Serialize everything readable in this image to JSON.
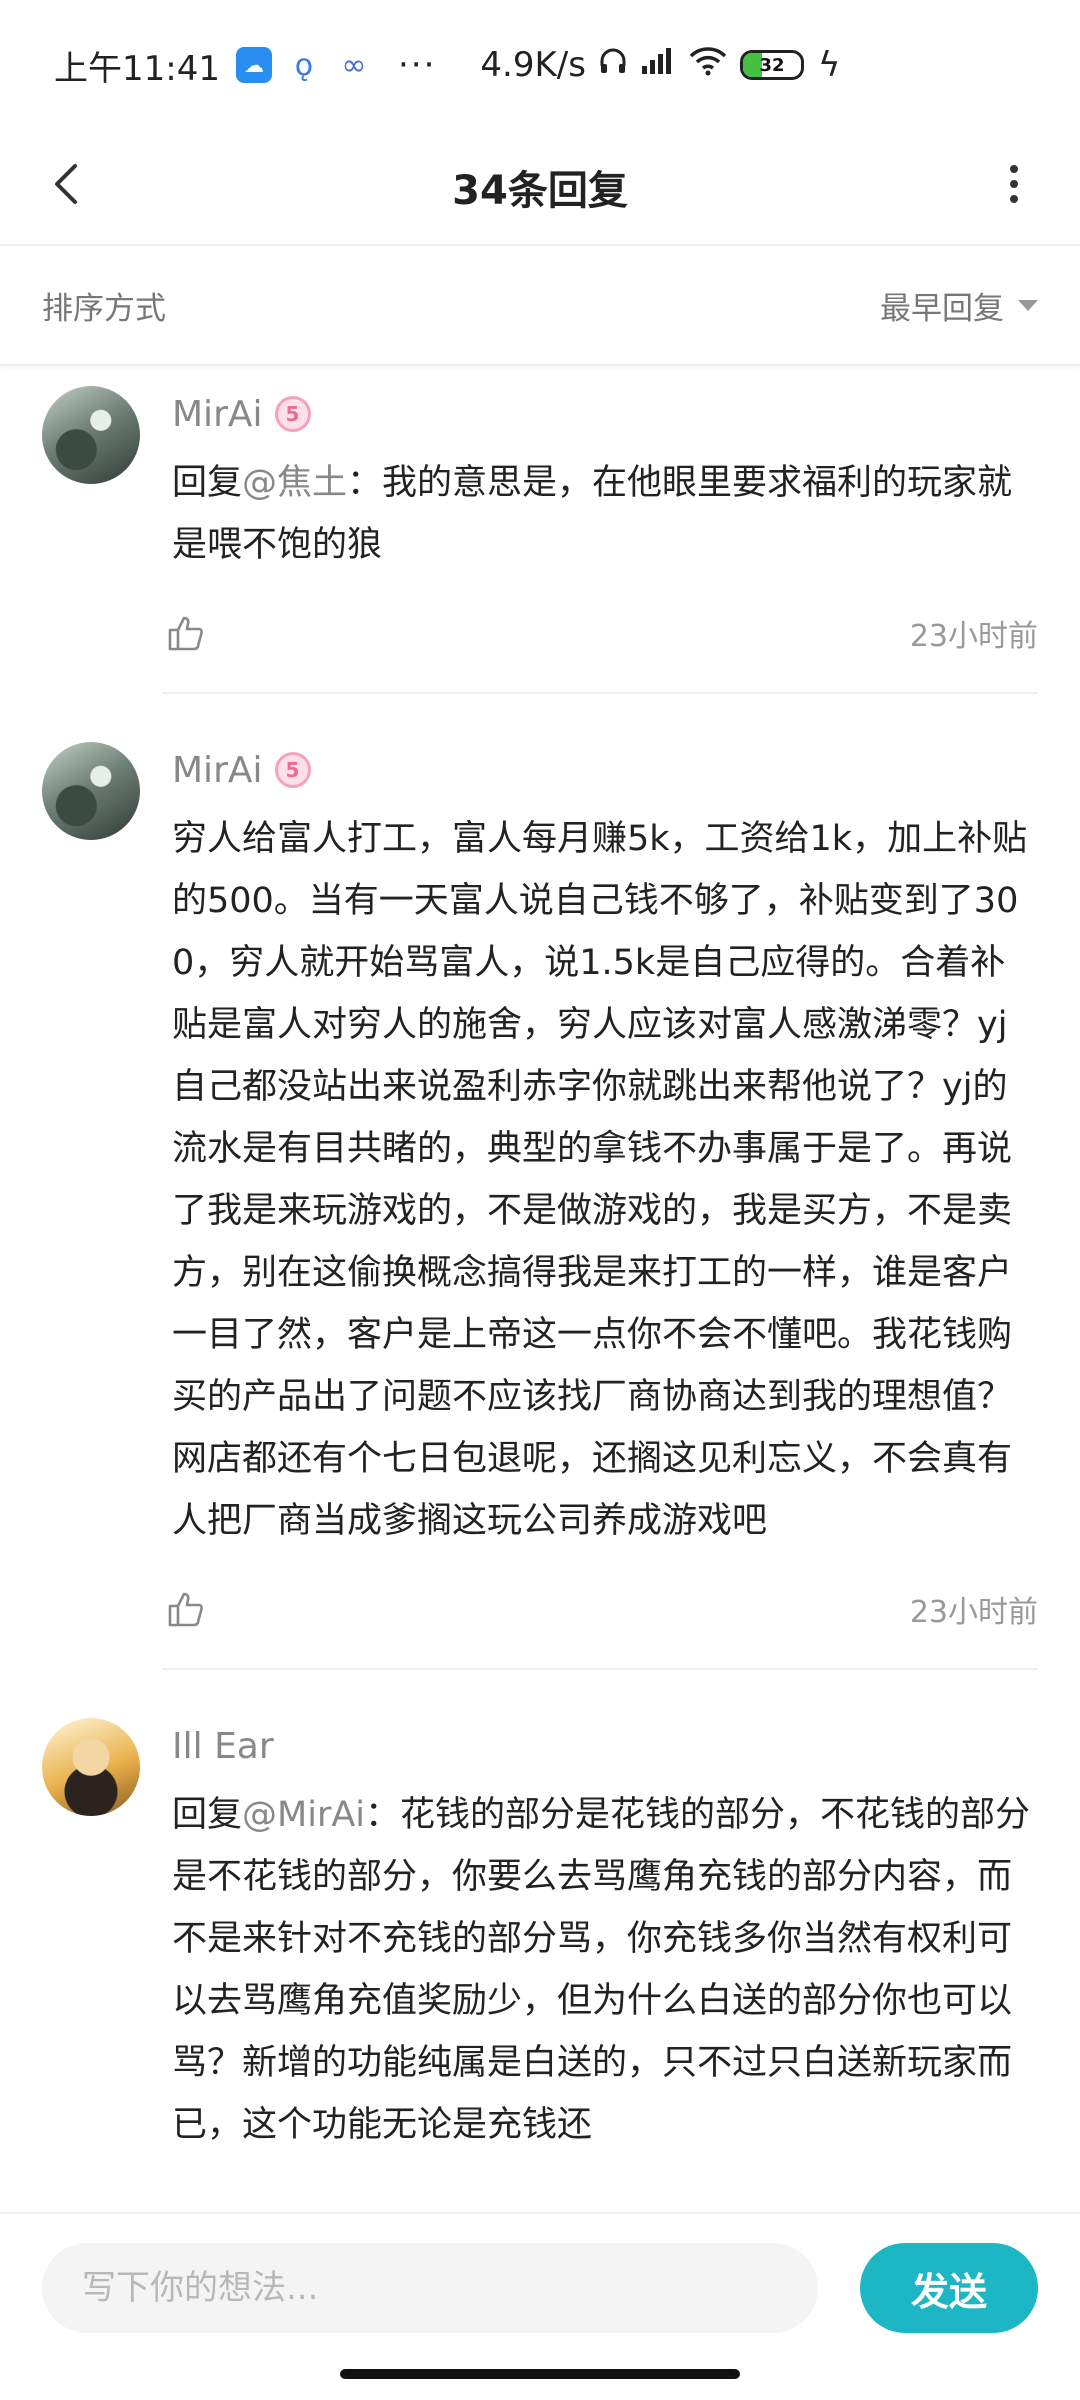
{
  "status_bar": {
    "time": "上午11:41",
    "more": "···",
    "network_speed": "4.9K/s",
    "battery_level": "32",
    "battery_fraction": 0.32
  },
  "header": {
    "title": "34条回复"
  },
  "sort": {
    "label": "排序方式",
    "selected": "最早回复"
  },
  "comments": [
    {
      "name": "MirAi",
      "level": "5",
      "reply_prefix": "回复",
      "mention": "@焦土",
      "text": "：我的意思是，在他眼里要求福利的玩家就是喂不饱的狼",
      "time": "23小时前"
    },
    {
      "name": "MirAi",
      "level": "5",
      "text": "穷人给富人打工，富人每月赚5k，工资给1k，加上补贴的500。当有一天富人说自己钱不够了，补贴变到了300，穷人就开始骂富人，说1.5k是自己应得的。合着补贴是富人对穷人的施舍，穷人应该对富人感激涕零？yj自己都没站出来说盈利赤字你就跳出来帮他说了？yj的流水是有目共睹的，典型的拿钱不办事属于是了。再说了我是来玩游戏的，不是做游戏的，我是买方，不是卖方，别在这偷换概念搞得我是来打工的一样，谁是客户一目了然，客户是上帝这一点你不会不懂吧。我花钱购买的产品出了问题不应该找厂商协商达到我的理想值？网店都还有个七日包退呢，还搁这见利忘义，不会真有人把厂商当成爹搁这玩公司养成游戏吧",
      "time": "23小时前"
    },
    {
      "name": "Ill Ear",
      "reply_prefix": "回复",
      "mention": "@MirAi",
      "text": "：花钱的部分是花钱的部分，不花钱的部分是不花钱的部分，你要么去骂鹰角充钱的部分内容，而不是来针对不充钱的部分骂，你充钱多你当然有权利可以去骂鹰角充值奖励少，但为什么白送的部分你也可以骂？新增的功能纯属是白送的，只不过只白送新玩家而已，这个功能无论是充钱还"
    }
  ],
  "input_bar": {
    "placeholder": "写下你的想法...",
    "send_label": "发送"
  },
  "colors": {
    "accent": "#1cb6c4",
    "level_badge": "#ef6b8e",
    "secondary_text": "#888888"
  }
}
